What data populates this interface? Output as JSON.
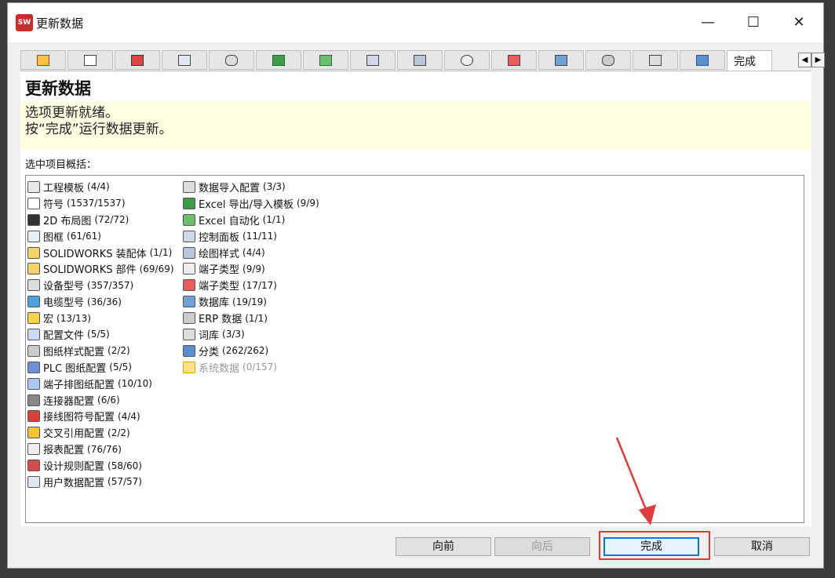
{
  "window": {
    "title": "更新数据",
    "app_icon_text": "SW"
  },
  "tabs": {
    "icons": [
      "cross-reference-icon",
      "table-icon",
      "design-rules-icon",
      "user-data-icon",
      "database-import-icon",
      "excel-export-icon",
      "excel-automation-icon",
      "control-panel-icon",
      "drawing-style-icon",
      "terminal-type-icon",
      "terminal-type2-icon",
      "library-icon",
      "database-icon",
      "dictionary-icon",
      "classification-icon"
    ],
    "active_label": "完成"
  },
  "header": {
    "title": "更新数据",
    "line1": "选项更新就绪。",
    "line2": "按“完成”运行数据更新。"
  },
  "summary_label": "选中项目概括：",
  "list": {
    "col1": [
      {
        "label": "工程模板",
        "count": "(4/4)"
      },
      {
        "label": "符号",
        "count": "(1537/1537)"
      },
      {
        "label": "2D 布局图",
        "count": "(72/72)"
      },
      {
        "label": "图框",
        "count": "(61/61)"
      },
      {
        "label": "SOLIDWORKS 装配体",
        "count": "(1/1)"
      },
      {
        "label": "SOLIDWORKS 部件",
        "count": "(69/69)"
      },
      {
        "label": "设备型号",
        "count": "(357/357)"
      },
      {
        "label": "电缆型号",
        "count": "(36/36)"
      },
      {
        "label": "宏",
        "count": "(13/13)"
      },
      {
        "label": "配置文件",
        "count": "(5/5)"
      },
      {
        "label": "图纸样式配置",
        "count": "(2/2)"
      },
      {
        "label": "PLC 图纸配置",
        "count": "(5/5)"
      },
      {
        "label": "端子排图纸配置",
        "count": "(10/10)"
      },
      {
        "label": "连接器配置",
        "count": "(6/6)"
      },
      {
        "label": "接线图符号配置",
        "count": "(4/4)"
      },
      {
        "label": "交叉引用配置",
        "count": "(2/2)"
      },
      {
        "label": "报表配置",
        "count": "(76/76)"
      },
      {
        "label": "设计规则配置",
        "count": "(58/60)"
      },
      {
        "label": "用户数据配置",
        "count": "(57/57)"
      }
    ],
    "col2": [
      {
        "label": "数据导入配置",
        "count": "(3/3)"
      },
      {
        "label": "Excel 导出/导入模板",
        "count": "(9/9)"
      },
      {
        "label": "Excel 自动化",
        "count": "(1/1)"
      },
      {
        "label": "控制面板",
        "count": "(11/11)"
      },
      {
        "label": "绘图样式",
        "count": "(4/4)"
      },
      {
        "label": "端子类型",
        "count": "(9/9)"
      },
      {
        "label": "端子类型",
        "count": "(17/17)"
      },
      {
        "label": "数据库",
        "count": "(19/19)"
      },
      {
        "label": "ERP 数据",
        "count": "(1/1)"
      },
      {
        "label": "词库",
        "count": "(3/3)"
      },
      {
        "label": "分类",
        "count": "(262/262)"
      },
      {
        "label": "系统数据",
        "count": "(0/157)"
      }
    ]
  },
  "buttons": {
    "back": "向前",
    "next": "向后",
    "finish": "完成",
    "cancel": "取消"
  },
  "colors": {
    "highlight": "#e03a3a",
    "info_bg": "#ffffe2",
    "primary_border": "#0078d7"
  }
}
